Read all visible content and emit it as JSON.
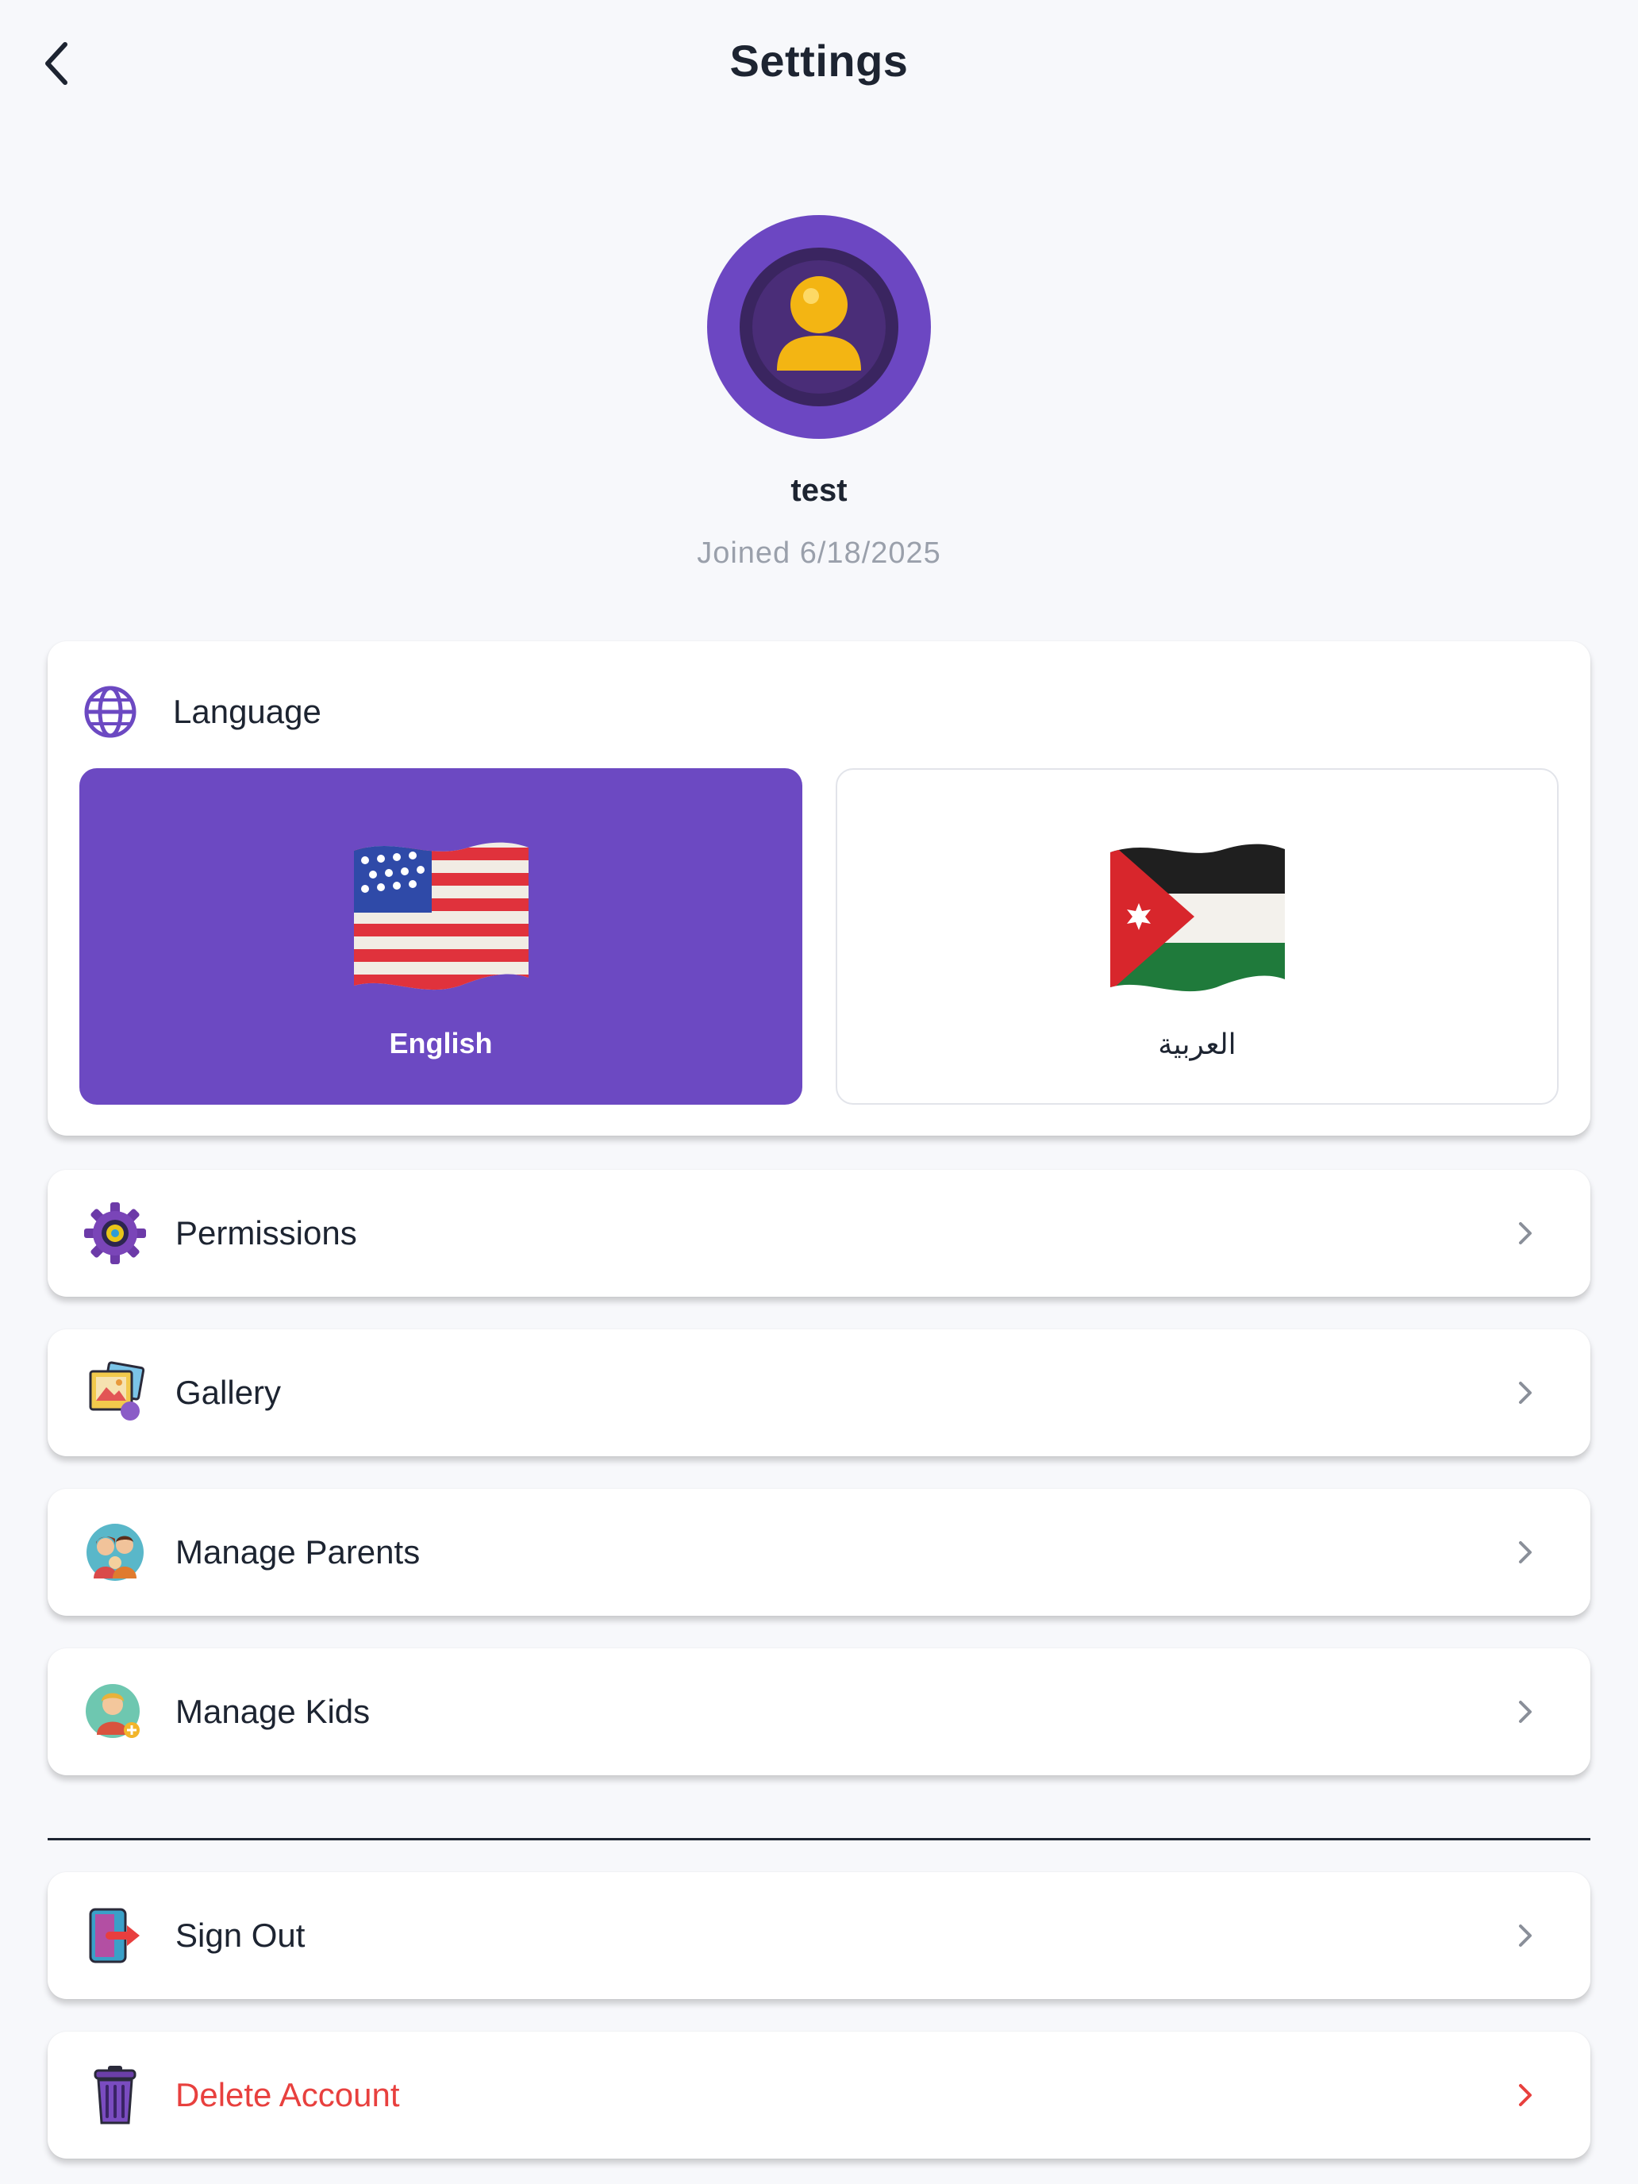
{
  "header": {
    "title": "Settings",
    "back_label": "Back"
  },
  "profile": {
    "name": "test",
    "joined": "Joined 6/18/2025"
  },
  "language": {
    "title": "Language",
    "options": [
      {
        "label": "English",
        "flag": "us-flag",
        "selected": true
      },
      {
        "label": "العربية",
        "flag": "jordan-flag",
        "selected": false
      }
    ]
  },
  "menu": {
    "permissions": "Permissions",
    "gallery": "Gallery",
    "manage_parents": "Manage Parents",
    "manage_kids": "Manage Kids",
    "sign_out": "Sign Out",
    "delete_account": "Delete Account"
  },
  "colors": {
    "accent": "#6c49c2",
    "danger": "#e8403e",
    "background": "#f7f8fb"
  }
}
